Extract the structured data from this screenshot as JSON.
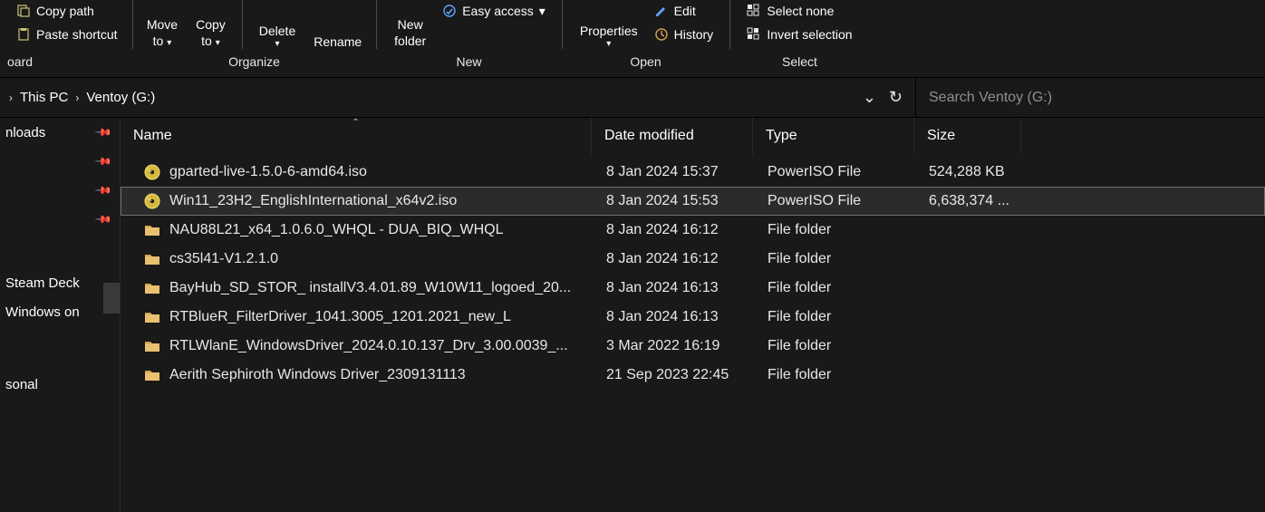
{
  "ribbon": {
    "clipboard": {
      "copy_path": "Copy path",
      "paste_shortcut": "Paste shortcut",
      "group_label": "oard"
    },
    "organize": {
      "move_to": "Move\nto",
      "copy_to": "Copy\nto",
      "delete": "Delete",
      "rename": "Rename",
      "group_label": "Organize"
    },
    "new_group": {
      "new_folder": "New\nfolder",
      "easy_access": "Easy access",
      "group_label": "New"
    },
    "open_group": {
      "properties": "Properties",
      "edit": "Edit",
      "history": "History",
      "group_label": "Open"
    },
    "select_group": {
      "select_none": "Select none",
      "invert_selection": "Invert selection",
      "group_label": "Select"
    }
  },
  "breadcrumb": {
    "root_sep": "›",
    "this_pc": "This PC",
    "sep": "›",
    "current": "Ventoy (G:)"
  },
  "addr_controls": {
    "dropdown": "⌄",
    "refresh": "↻"
  },
  "search": {
    "placeholder": "Search Ventoy (G:)"
  },
  "sidebar": {
    "items": [
      {
        "label": "nloads",
        "pinned": true
      },
      {
        "label": "",
        "pinned": true
      },
      {
        "label": "",
        "pinned": true
      },
      {
        "label": "",
        "pinned": true
      }
    ],
    "section2": [
      {
        "label": "Steam Deck"
      },
      {
        "label": "Windows on"
      }
    ],
    "section3": [
      {
        "label": "sonal"
      }
    ]
  },
  "columns": {
    "name": "Name",
    "date": "Date modified",
    "type": "Type",
    "size": "Size"
  },
  "files": [
    {
      "icon": "disc",
      "name": "gparted-live-1.5.0-6-amd64.iso",
      "date": "8 Jan 2024 15:37",
      "type": "PowerISO File",
      "size": "524,288 KB",
      "selected": false
    },
    {
      "icon": "disc",
      "name": "Win11_23H2_EnglishInternational_x64v2.iso",
      "date": "8 Jan 2024 15:53",
      "type": "PowerISO File",
      "size": "6,638,374 ...",
      "selected": true
    },
    {
      "icon": "folder",
      "name": "NAU88L21_x64_1.0.6.0_WHQL - DUA_BIQ_WHQL",
      "date": "8 Jan 2024 16:12",
      "type": "File folder",
      "size": "",
      "selected": false
    },
    {
      "icon": "folder",
      "name": "cs35l41-V1.2.1.0",
      "date": "8 Jan 2024 16:12",
      "type": "File folder",
      "size": "",
      "selected": false
    },
    {
      "icon": "folder",
      "name": "BayHub_SD_STOR_ installV3.4.01.89_W10W11_logoed_20...",
      "date": "8 Jan 2024 16:13",
      "type": "File folder",
      "size": "",
      "selected": false
    },
    {
      "icon": "folder",
      "name": "RTBlueR_FilterDriver_1041.3005_1201.2021_new_L",
      "date": "8 Jan 2024 16:13",
      "type": "File folder",
      "size": "",
      "selected": false
    },
    {
      "icon": "folder",
      "name": "RTLWlanE_WindowsDriver_2024.0.10.137_Drv_3.00.0039_...",
      "date": "3 Mar 2022 16:19",
      "type": "File folder",
      "size": "",
      "selected": false
    },
    {
      "icon": "folder",
      "name": "Aerith Sephiroth Windows Driver_2309131113",
      "date": "21 Sep 2023 22:45",
      "type": "File folder",
      "size": "",
      "selected": false
    }
  ]
}
